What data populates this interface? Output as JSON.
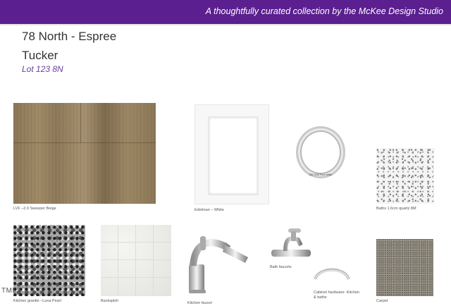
{
  "header": {
    "tagline": "A thoughtfully curated collection by the McKee Design Studio"
  },
  "project": {
    "community": "78 North - Espree",
    "plan": "Tucker",
    "lot": "Lot 123 8N"
  },
  "selections": {
    "lvf": "LVF –2.0  Sweeper Beige",
    "cabinet": "Edelman – White",
    "paint_label": "SW 7005 Pure White",
    "baths": "Baths 1.6cm quartz 8M",
    "granite": "Kitchen granite –Luna Pearl",
    "backsplash": "Backsplsh",
    "kitchen_faucet": "Kitchen faucet",
    "bath_faucets": "Bath faucets",
    "hardware": "Cabinet hardware- Kitchen & baths",
    "carpet": "Carpet"
  },
  "watermark": "TMLS",
  "colors": {
    "banner": "#5b1f8f",
    "lot_text": "#6b3fa0"
  }
}
